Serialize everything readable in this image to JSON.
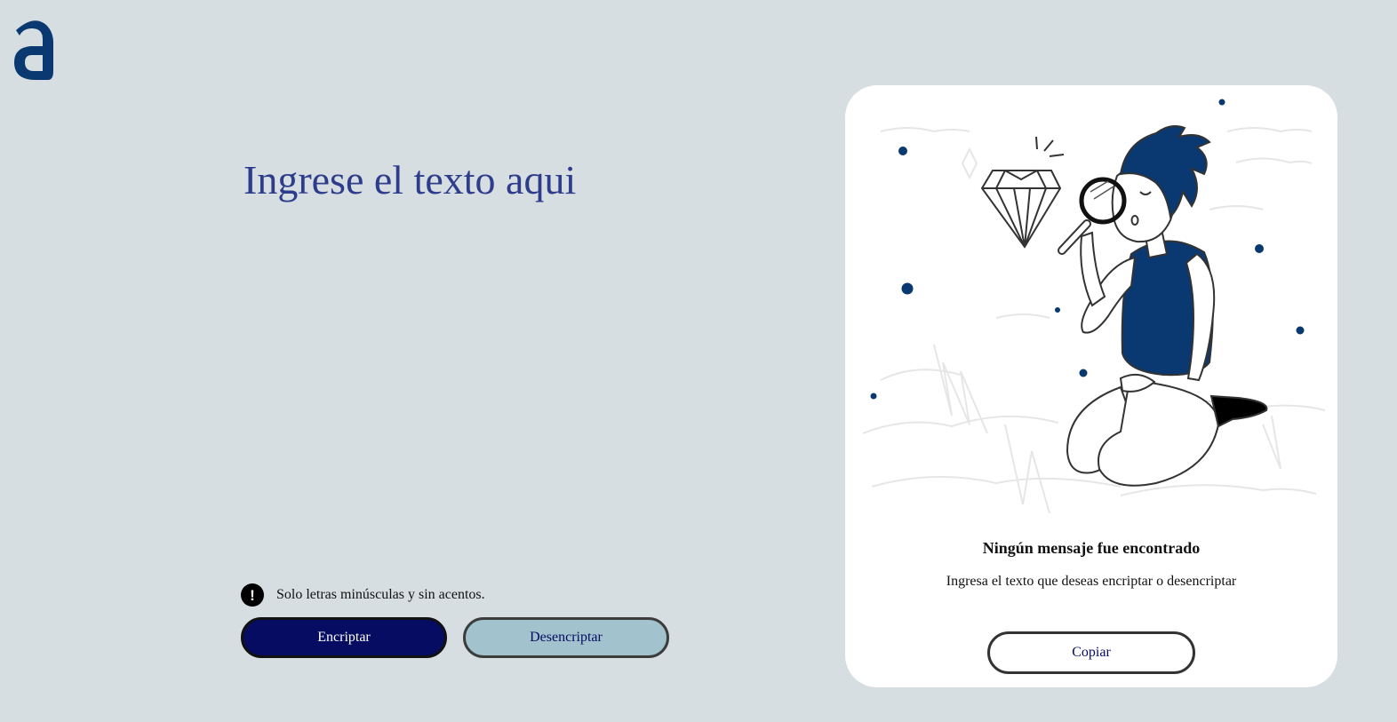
{
  "colors": {
    "background": "#d6dee1",
    "brand": "#0a3871",
    "primary_button": "#050c61",
    "secondary_button": "#a2c3cd",
    "panel": "#ffffff"
  },
  "logo": {
    "icon": "alura-a-logo"
  },
  "input": {
    "placeholder": "Ingrese el texto aqui",
    "value": ""
  },
  "hint": {
    "icon": "exclamation-circle-icon",
    "text": "Solo letras minúsculas y sin acentos."
  },
  "buttons": {
    "encrypt_label": "Encriptar",
    "decrypt_label": "Desencriptar"
  },
  "output_panel": {
    "illustration": "person-with-magnifying-glass-and-diamond",
    "title": "Ningún mensaje fue encontrado",
    "subtitle": "Ingresa el texto que deseas encriptar o desencriptar",
    "copy_label": "Copiar"
  }
}
